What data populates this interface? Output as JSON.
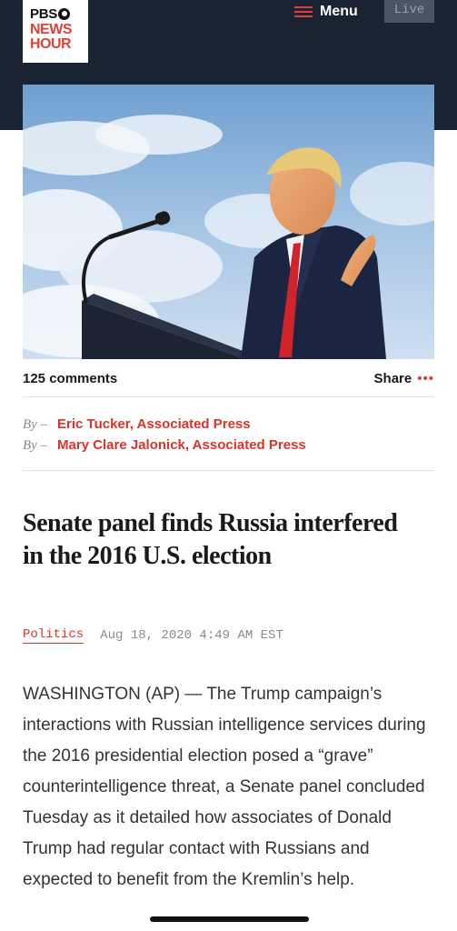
{
  "header": {
    "logo": {
      "line1": "PBS",
      "line2": "NEWS",
      "line3": "HOUR"
    },
    "menu_label": "Menu",
    "live_label": "Live"
  },
  "article_meta": {
    "comments": "125 comments",
    "share_label": "Share",
    "share_dots": "•••"
  },
  "bylines": [
    {
      "prefix": "By –",
      "author": "Eric Tucker, Associated Press"
    },
    {
      "prefix": "By –",
      "author": "Mary Clare Jalonick, Associated Press"
    }
  ],
  "headline": "Senate panel finds Russia interfered in the 2016 U.S. election",
  "category": "Politics",
  "published": "Aug 18, 2020 4:49 AM EST",
  "body": "WASHINGTON (AP) — The Trump campaign’s interactions with Russian intelligence services during the 2016 presidential election posed a “grave” counterintelligence threat, a Senate panel concluded Tuesday as it detailed how associates of Donald Trump had regular contact with Russians and expected to benefit from the Kremlin’s help.",
  "colors": {
    "header_bg": "#1a2332",
    "accent_red": "#e0403a",
    "byline_red": "#d9342b"
  }
}
